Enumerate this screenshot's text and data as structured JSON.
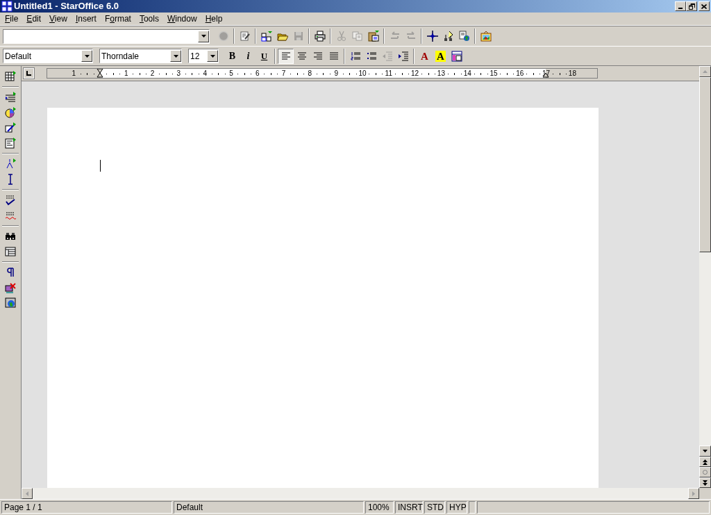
{
  "window": {
    "title": "Untitled1 - StarOffice 6.0"
  },
  "menu": [
    {
      "key": "F",
      "post": "ile"
    },
    {
      "key": "E",
      "post": "dit"
    },
    {
      "key": "V",
      "post": "iew"
    },
    {
      "key": "I",
      "post": "nsert"
    },
    {
      "pre": "F",
      "key": "o",
      "post": "rmat"
    },
    {
      "key": "T",
      "post": "ools"
    },
    {
      "key": "W",
      "post": "indow"
    },
    {
      "key": "H",
      "post": "elp"
    }
  ],
  "function_bar": {
    "buttons": [
      {
        "disabled": true
      },
      {
        "disabled": false
      },
      {
        "disabled": false
      },
      {
        "disabled": false
      },
      {
        "disabled": true
      },
      {
        "disabled": false
      },
      {
        "disabled": true
      },
      {
        "disabled": true
      },
      {
        "disabled": false
      },
      {
        "disabled": true
      },
      {
        "disabled": true
      },
      {
        "disabled": false
      },
      {
        "disabled": false
      },
      {
        "disabled": false
      },
      {
        "disabled": false
      }
    ]
  },
  "object_bar": {
    "paragraph_style": "Default",
    "font": "Thorndale",
    "size": "12",
    "groups": [
      [
        {
          "kind": "bold",
          "label": "B"
        },
        {
          "kind": "italic",
          "label": "i"
        },
        {
          "kind": "underline",
          "label": "U"
        }
      ],
      [
        {
          "kind": "align",
          "selected": true
        },
        {
          "kind": "align",
          "selected": false
        },
        {
          "kind": "align",
          "selected": false
        },
        {
          "kind": "align",
          "selected": false
        }
      ],
      [
        {
          "kind": "icon",
          "disabled": false
        },
        {
          "kind": "icon",
          "disabled": false
        },
        {
          "kind": "icon",
          "disabled": true
        },
        {
          "kind": "icon",
          "disabled": false
        }
      ],
      [
        {
          "kind": "fontcolor",
          "label": "A",
          "color": "#a00000"
        },
        {
          "kind": "highlight",
          "label": "A",
          "color": "#ffff00"
        },
        {
          "kind": "icon",
          "disabled": false
        }
      ]
    ]
  },
  "ruler": {
    "labels": [
      "1",
      "1",
      "2",
      "3",
      "4",
      "5",
      "6",
      "7",
      "8",
      "9",
      "10",
      "11",
      "12",
      "13",
      "14",
      "15",
      "16",
      "17",
      "18"
    ]
  },
  "status_bar": {
    "fields": [
      "Page 1 / 1",
      "Default",
      "100%",
      "INSRT",
      "STD",
      "HYP"
    ]
  }
}
